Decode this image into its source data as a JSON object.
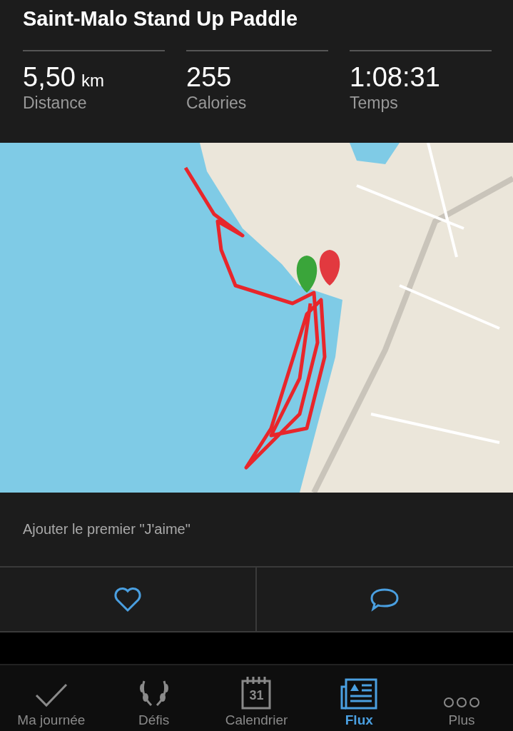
{
  "activity": {
    "title": "Saint-Malo Stand Up Paddle"
  },
  "stats": [
    {
      "value": "5,50",
      "unit": "km",
      "label": "Distance"
    },
    {
      "value": "255",
      "label": "Calories"
    },
    {
      "value": "1:08:31",
      "label": "Temps"
    }
  ],
  "likes_text": "Ajouter le premier \"J'aime\"",
  "actions": [
    {
      "kind": "like"
    },
    {
      "kind": "comment"
    }
  ],
  "tab_bar": [
    {
      "kind": "check",
      "label": "Ma journée",
      "selected": false
    },
    {
      "kind": "laurel",
      "label": "Défis",
      "selected": false
    },
    {
      "kind": "calendar",
      "label": "Calendrier",
      "icon_text": "31",
      "selected": false
    },
    {
      "kind": "feed",
      "label": "Flux",
      "selected": true
    },
    {
      "kind": "more",
      "label": "Plus",
      "selected": false
    }
  ]
}
